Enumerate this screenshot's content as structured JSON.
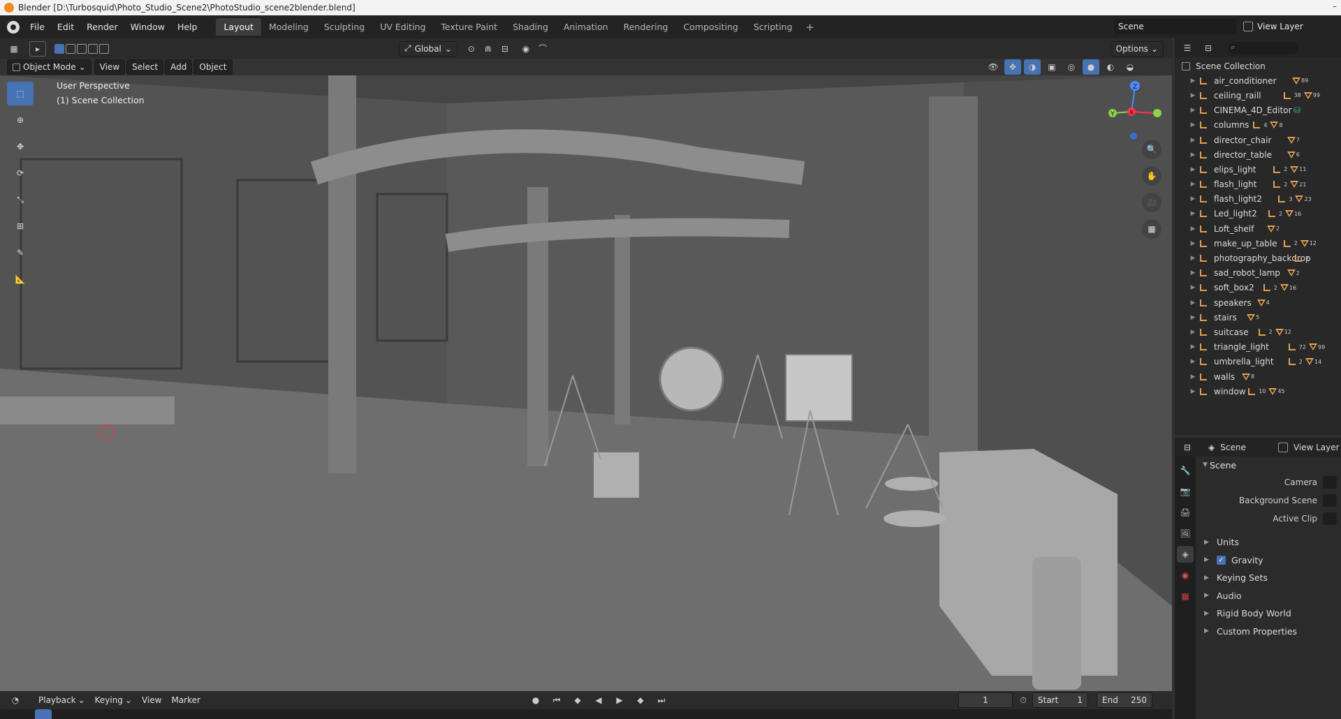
{
  "window": {
    "title": "Blender [D:\\Turbosquid\\Photo_Studio_Scene2\\PhotoStudio_scene2blender.blend]"
  },
  "menu": [
    "File",
    "Edit",
    "Render",
    "Window",
    "Help"
  ],
  "workspaces": [
    "Layout",
    "Modeling",
    "Sculpting",
    "UV Editing",
    "Texture Paint",
    "Shading",
    "Animation",
    "Rendering",
    "Compositing",
    "Scripting"
  ],
  "active_workspace": "Layout",
  "scene_field": "Scene",
  "view_layer_label": "View Layer",
  "viewport": {
    "transform_orientation": "Global",
    "options_label": "Options",
    "mode": "Object Mode",
    "menus": [
      "View",
      "Select",
      "Add",
      "Object"
    ],
    "perspective_text": "User Perspective",
    "collection_text": "(1) Scene Collection",
    "gizmo_axes": {
      "z": "Z",
      "y": "Y",
      "x": "X"
    }
  },
  "timeline": {
    "menus": [
      "Playback",
      "Keying",
      "View",
      "Marker"
    ],
    "current_frame": "1",
    "start_label": "Start",
    "start_value": "1",
    "end_label": "End",
    "end_value": "250"
  },
  "outliner": {
    "root": "Scene Collection",
    "items": [
      {
        "name": "air_conditioner",
        "b1": "",
        "b2": "89"
      },
      {
        "name": "ceiling_raill",
        "b1": "38",
        "b2": "99"
      },
      {
        "name": "CINEMA_4D_Editor",
        "b1": "",
        "b2": ""
      },
      {
        "name": "columns",
        "b1": "4",
        "b2": "8"
      },
      {
        "name": "director_chair",
        "b1": "",
        "b2": "7"
      },
      {
        "name": "director_table",
        "b1": "",
        "b2": "6"
      },
      {
        "name": "elips_light",
        "b1": "2",
        "b2": "11"
      },
      {
        "name": "flash_light",
        "b1": "2",
        "b2": "21"
      },
      {
        "name": "flash_light2",
        "b1": "3",
        "b2": "23"
      },
      {
        "name": "Led_light2",
        "b1": "2",
        "b2": "16"
      },
      {
        "name": "Loft_shelf",
        "b1": "",
        "b2": "2"
      },
      {
        "name": "make_up_table",
        "b1": "2",
        "b2": "12"
      },
      {
        "name": "photography_backdrop",
        "b1": "2",
        "b2": ""
      },
      {
        "name": "sad_robot_lamp",
        "b1": "",
        "b2": "2"
      },
      {
        "name": "soft_box2",
        "b1": "2",
        "b2": "16"
      },
      {
        "name": "speakers",
        "b1": "",
        "b2": "4"
      },
      {
        "name": "stairs",
        "b1": "",
        "b2": "5"
      },
      {
        "name": "suitcase",
        "b1": "2",
        "b2": "12"
      },
      {
        "name": "triangle_light",
        "b1": "72",
        "b2": "99"
      },
      {
        "name": "umbrella_light",
        "b1": "2",
        "b2": "14"
      },
      {
        "name": "walls",
        "b1": "",
        "b2": "8"
      },
      {
        "name": "window",
        "b1": "10",
        "b2": "45"
      }
    ]
  },
  "properties": {
    "header_scene": "Scene",
    "header_view_layer": "View Layer",
    "panel_title": "Scene",
    "fields": [
      {
        "label": "Camera"
      },
      {
        "label": "Background Scene"
      },
      {
        "label": "Active Clip"
      }
    ],
    "subpanels": [
      "Units",
      "Gravity",
      "Keying Sets",
      "Audio",
      "Rigid Body World",
      "Custom Properties"
    ],
    "gravity_checked": true
  },
  "colors": {
    "accent": "#4772b3",
    "object_orange": "#e0a050"
  }
}
